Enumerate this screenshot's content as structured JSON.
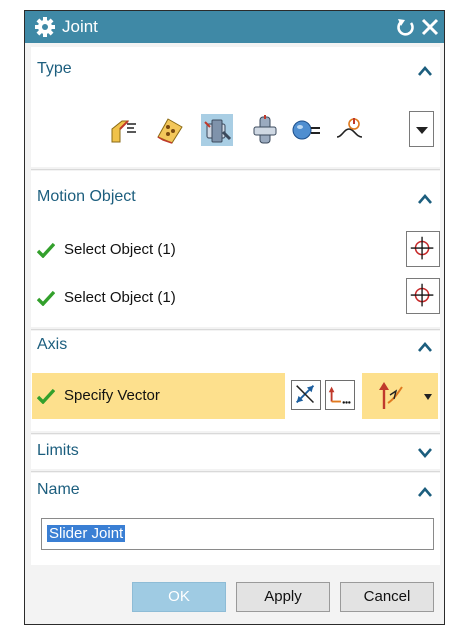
{
  "dialog": {
    "title": "Joint"
  },
  "type_section": {
    "label": "Type"
  },
  "motion_section": {
    "label": "Motion Object",
    "rows": [
      {
        "label": "Select Object (1)"
      },
      {
        "label": "Select Object (1)"
      }
    ]
  },
  "axis_section": {
    "label": "Axis",
    "vector_label": "Specify Vector"
  },
  "limits_section": {
    "label": "Limits"
  },
  "name_section": {
    "label": "Name",
    "value": "Slider Joint"
  },
  "buttons": {
    "ok": "OK",
    "apply": "Apply",
    "cancel": "Cancel"
  },
  "colors": {
    "titlebar": "#3f89a6",
    "section_header": "#1c5e7e",
    "highlight": "#fde08d",
    "check": "#33a02c"
  }
}
